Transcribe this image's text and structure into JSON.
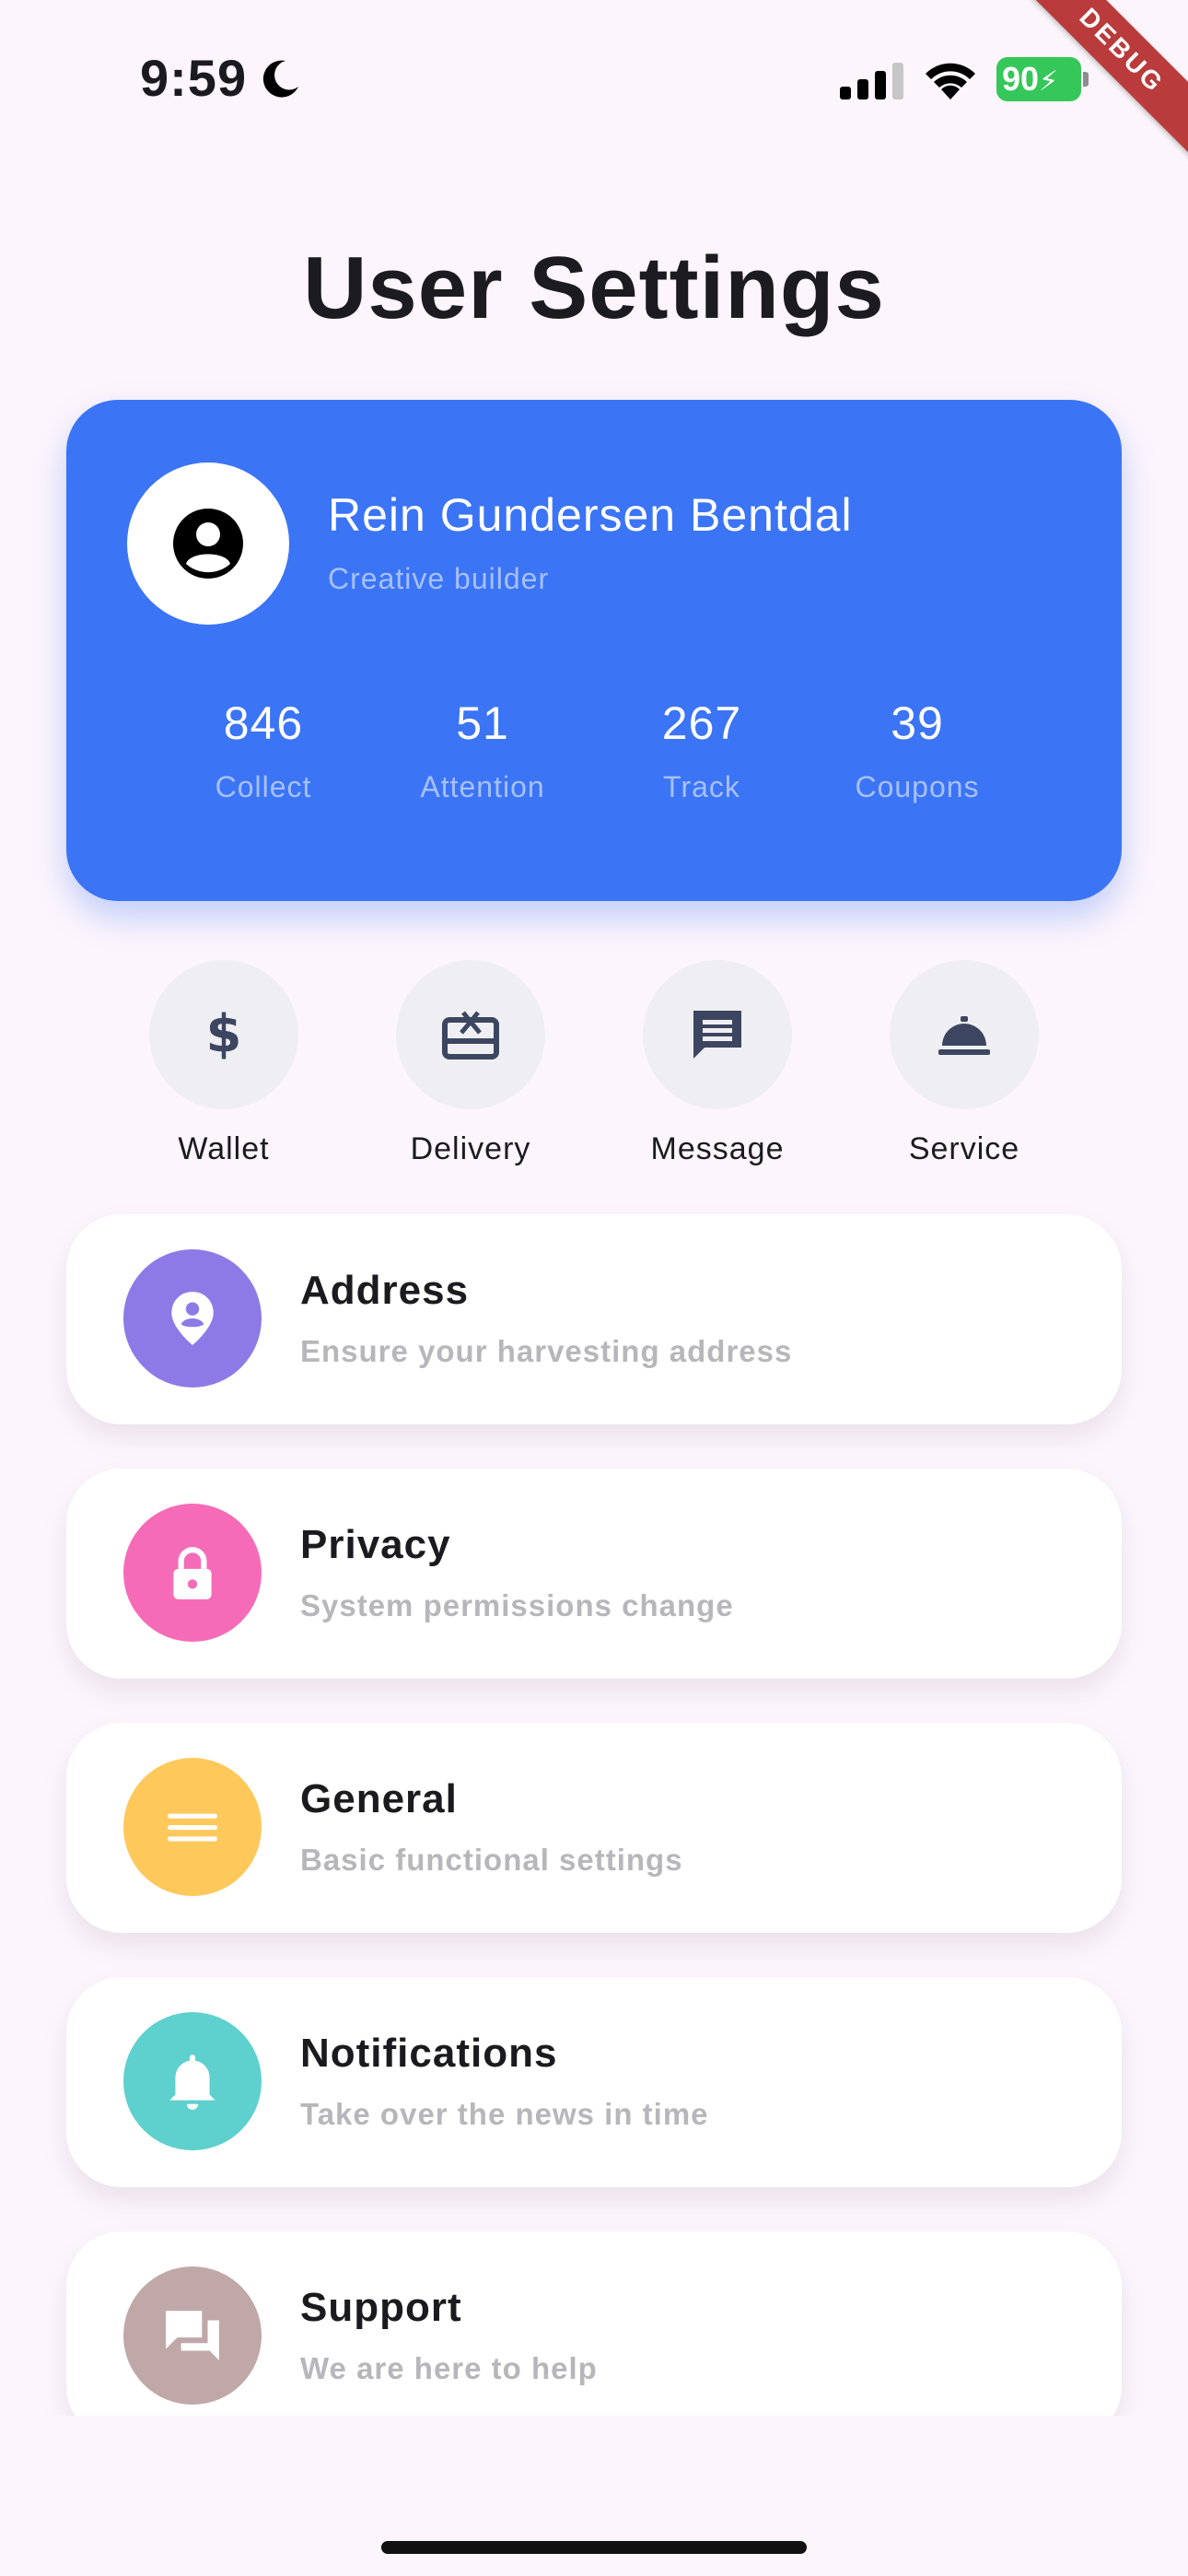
{
  "status_bar": {
    "time": "9:59",
    "battery": "90",
    "debug_label": "DEBUG"
  },
  "page": {
    "title": "User Settings"
  },
  "profile": {
    "name": "Rein Gundersen Bentdal",
    "subtitle": "Creative builder",
    "stats": [
      {
        "value": "846",
        "label": "Collect"
      },
      {
        "value": "51",
        "label": "Attention"
      },
      {
        "value": "267",
        "label": "Track"
      },
      {
        "value": "39",
        "label": "Coupons"
      }
    ]
  },
  "quick_actions": [
    {
      "label": "Wallet",
      "icon": "dollar-icon"
    },
    {
      "label": "Delivery",
      "icon": "gift-card-icon"
    },
    {
      "label": "Message",
      "icon": "message-icon"
    },
    {
      "label": "Service",
      "icon": "service-bell-icon"
    }
  ],
  "settings": [
    {
      "title": "Address",
      "description": "Ensure your harvesting address",
      "icon": "location-pin-icon",
      "color": "#8E7AE6"
    },
    {
      "title": "Privacy",
      "description": "System permissions change",
      "icon": "lock-icon",
      "color": "#F56BB8"
    },
    {
      "title": "General",
      "description": "Basic functional settings",
      "icon": "menu-lines-icon",
      "color": "#FFC85A"
    },
    {
      "title": "Notifications",
      "description": "Take over the news in time",
      "icon": "bell-icon",
      "color": "#5ED0CE"
    },
    {
      "title": "Support",
      "description": "We are here to help",
      "icon": "chat-bubbles-icon",
      "color": "#C0A8A8"
    }
  ],
  "colors": {
    "background": "#FCF5FC",
    "card_blue": "#3B74F5",
    "quick_circle": "#EFEFF3",
    "quick_icon": "#3D4660"
  }
}
